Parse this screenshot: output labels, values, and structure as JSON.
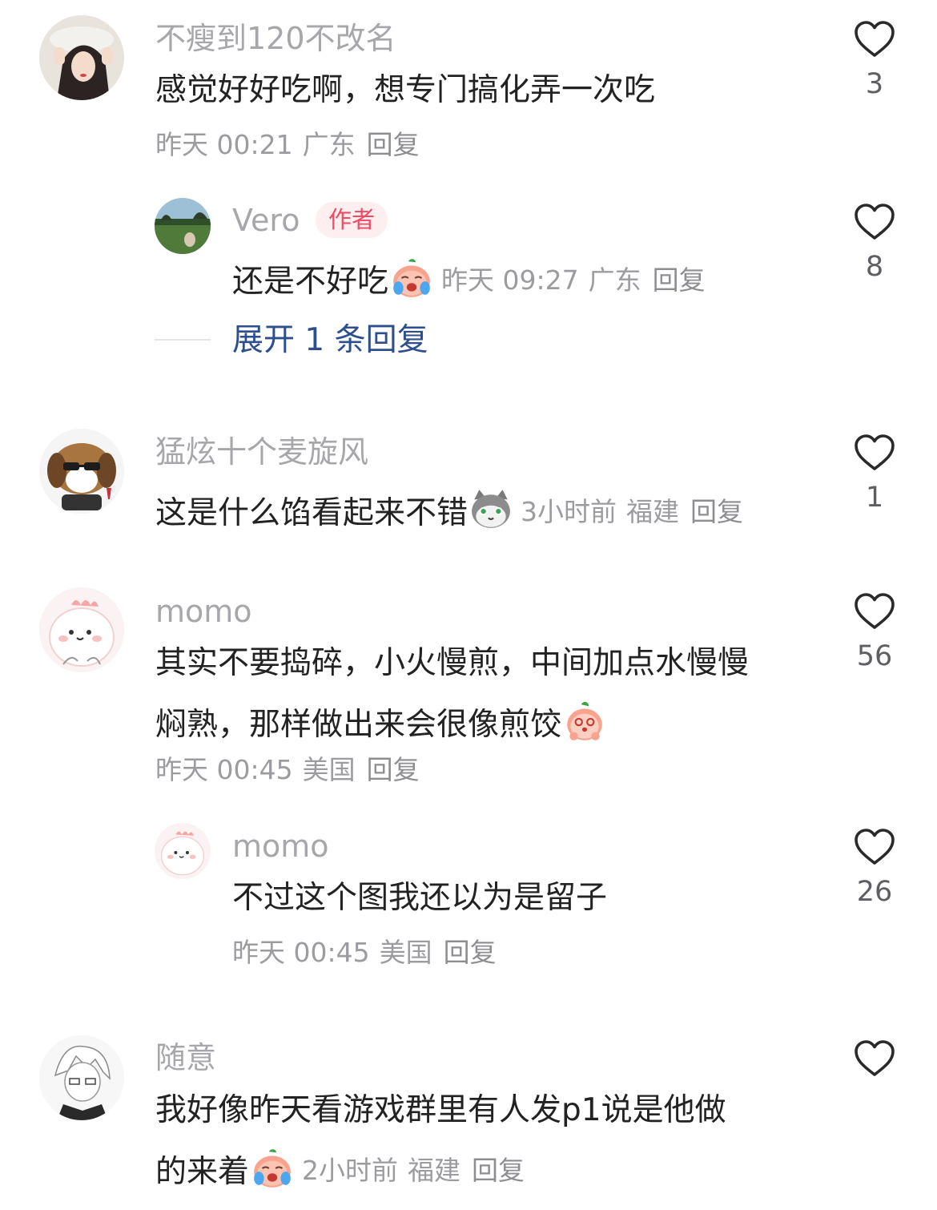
{
  "comments": [
    {
      "author": "不瘦到120不改名",
      "text": "感觉好好吃啊，想专门搞化弄一次吃",
      "time": "昨天 00:21",
      "location": "广东",
      "reply_label": "回复",
      "likes": "3",
      "avatar_icon": "girl-photo-avatar"
    },
    {
      "author": "Vero",
      "author_badge": "作者",
      "text": "还是不好吃",
      "text_emoji": "crying-peach-emoji",
      "time": "昨天 09:27",
      "location": "广东",
      "reply_label": "回复",
      "likes": "8",
      "avatar_icon": "golf-course-avatar",
      "is_reply": true
    },
    {
      "author": "猛炫十个麦旋风",
      "text": "这是什么馅看起来不错",
      "text_emoji": "cat-emoji",
      "time": "3小时前",
      "location": "福建",
      "reply_label": "回复",
      "likes": "1",
      "avatar_icon": "sunglasses-dog-avatar"
    },
    {
      "author": "momo",
      "text_line1": "其实不要捣碎，小火慢煎，中间加点水慢慢",
      "text_line2": "焖熟，那样做出来会很像煎饺",
      "text_emoji": "shy-peach-emoji",
      "time": "昨天 00:45",
      "location": "美国",
      "reply_label": "回复",
      "likes": "56",
      "avatar_icon": "pink-dino-avatar"
    },
    {
      "author": "momo",
      "text": "不过这个图我还以为是留子",
      "time": "昨天 00:45",
      "location": "美国",
      "reply_label": "回复",
      "likes": "26",
      "avatar_icon": "pink-dino-avatar",
      "is_reply": true
    },
    {
      "author": "随意",
      "text_line1": "我好像昨天看游戏群里有人发p1说是他做",
      "text_line2": "的来着",
      "text_emoji": "crying-peach-emoji",
      "time": "2小时前",
      "location": "福建",
      "reply_label": "回复",
      "likes": "",
      "avatar_icon": "sketch-anime-avatar"
    }
  ],
  "expand_replies": "展开 1 条回复",
  "colors": {
    "name": "#a7a7ab",
    "text": "#222222",
    "meta": "#9c9ca0",
    "badge_bg": "#fdeef0",
    "badge_text": "#f24a63",
    "expand_link": "#2d4f8e"
  },
  "like_icon": "heart-outline-icon"
}
